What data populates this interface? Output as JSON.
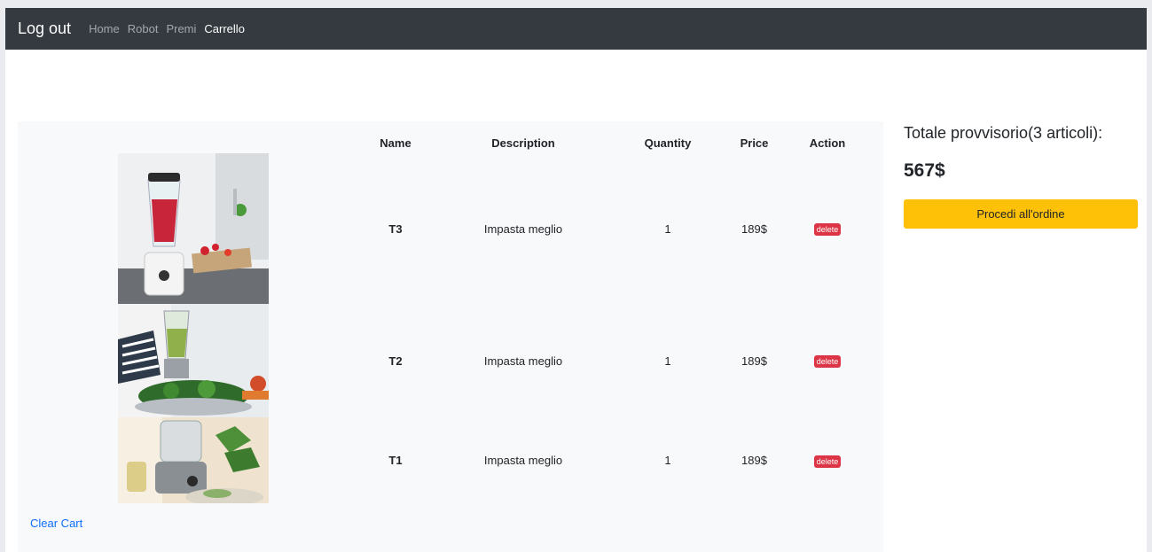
{
  "navbar": {
    "brand": "Log out",
    "links": [
      {
        "label": "Home",
        "active": false
      },
      {
        "label": "Robot",
        "active": false
      },
      {
        "label": "Premi",
        "active": false
      },
      {
        "label": "Carrello",
        "active": true
      }
    ]
  },
  "cart": {
    "headers": [
      "Name",
      "Description",
      "Quantity",
      "Price",
      "Action"
    ],
    "items": [
      {
        "name": "T3",
        "description": "Impasta meglio",
        "quantity": "1",
        "price": "189$",
        "action": "delete"
      },
      {
        "name": "T2",
        "description": "Impasta meglio",
        "quantity": "1",
        "price": "189$",
        "action": "delete"
      },
      {
        "name": "T1",
        "description": "Impasta meglio",
        "quantity": "1",
        "price": "189$",
        "action": "delete"
      }
    ],
    "clear_label": "Clear Cart"
  },
  "summary": {
    "title": "Totale provvisorio(3 articoli):",
    "total": "567$",
    "order_button": "Procedi all'ordine"
  },
  "colors": {
    "navbar": "#343a40",
    "panel": "#f8f9fa",
    "danger": "#dc3545",
    "warning": "#ffc107",
    "link": "#0d6efd"
  }
}
